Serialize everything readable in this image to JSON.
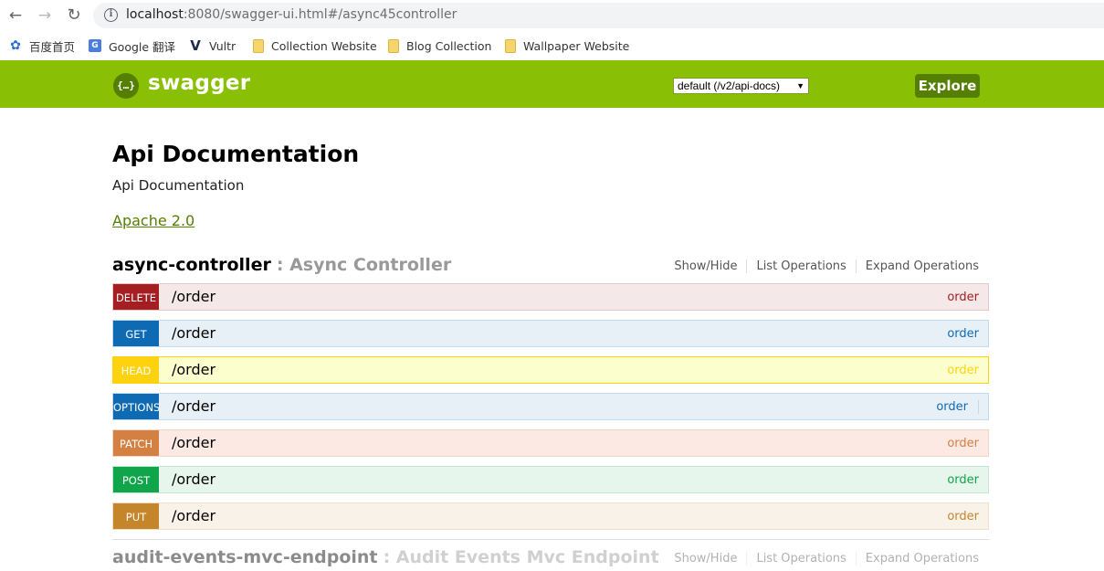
{
  "browser": {
    "url_host": "localhost",
    "url_rest": ":8080/swagger-ui.html#/async45controller",
    "bookmarks": [
      {
        "label": "百度首页",
        "icon": "baidu-paw-icon"
      },
      {
        "label": "Google 翻译",
        "icon": "google-translate-icon"
      },
      {
        "label": "Vultr",
        "icon": "vultr-icon"
      },
      {
        "label": "Collection Website",
        "icon": "folder-icon"
      },
      {
        "label": "Blog Collection",
        "icon": "folder-icon"
      },
      {
        "label": "Wallpaper Website",
        "icon": "folder-icon"
      }
    ]
  },
  "header": {
    "logo_text": "swagger",
    "logo_glyph": "{…}",
    "spec_selected": "default (/v2/api-docs)",
    "explore_label": "Explore",
    "brand_color": "#89bf04"
  },
  "info": {
    "title": "Api Documentation",
    "description": "Api Documentation",
    "license": "Apache 2.0"
  },
  "resources": [
    {
      "name": "async-controller",
      "description": ": Async Controller",
      "actions": [
        "Show/Hide",
        "List Operations",
        "Expand Operations"
      ],
      "operations": [
        {
          "method": "DELETE",
          "path": "/order",
          "tag": "order",
          "color": "#a41e22"
        },
        {
          "method": "GET",
          "path": "/order",
          "tag": "order",
          "color": "#0f6ab4"
        },
        {
          "method": "HEAD",
          "path": "/order",
          "tag": "order",
          "color": "#ffd20f"
        },
        {
          "method": "OPTIONS",
          "path": "/order",
          "tag": "order",
          "color": "#0f6ab4"
        },
        {
          "method": "PATCH",
          "path": "/order",
          "tag": "order",
          "color": "#d38042"
        },
        {
          "method": "POST",
          "path": "/order",
          "tag": "order",
          "color": "#10a54a"
        },
        {
          "method": "PUT",
          "path": "/order",
          "tag": "order",
          "color": "#c5862b"
        }
      ]
    },
    {
      "name": "audit-events-mvc-endpoint",
      "description": ": Audit Events Mvc Endpoint",
      "actions": [
        "Show/Hide",
        "List Operations",
        "Expand Operations"
      ]
    }
  ]
}
